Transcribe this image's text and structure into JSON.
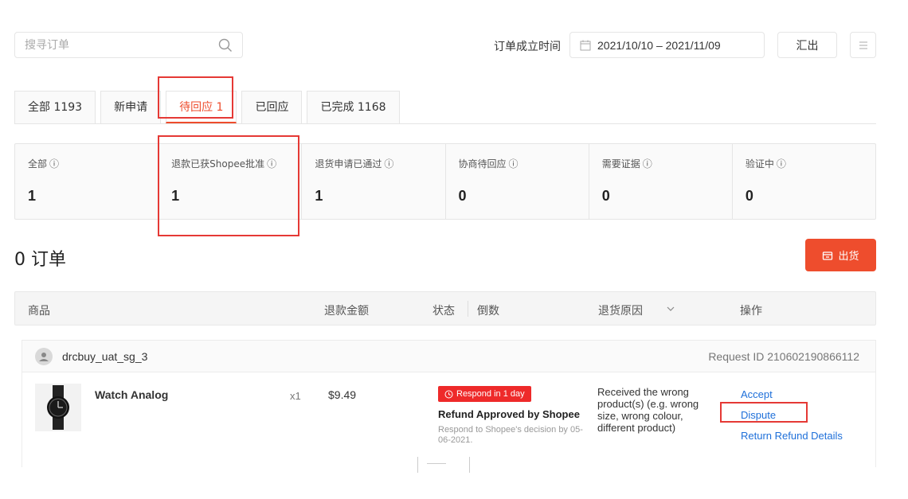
{
  "search": {
    "placeholder": "搜寻订单"
  },
  "date_filter": {
    "label": "订单成立时间",
    "range": "2021/10/10 – 2021/11/09"
  },
  "export_label": "汇出",
  "tabs": [
    {
      "label": "全部 1193",
      "active": false
    },
    {
      "label": "新申请",
      "active": false
    },
    {
      "label": "待回应 1",
      "active": true
    },
    {
      "label": "已回应",
      "active": false
    },
    {
      "label": "已完成 1168",
      "active": false
    }
  ],
  "stats": [
    {
      "label": "全部",
      "value": "1"
    },
    {
      "label": "退款已获Shopee批准",
      "value": "1"
    },
    {
      "label": "退货申请已通过",
      "value": "1"
    },
    {
      "label": "协商待回应",
      "value": "0"
    },
    {
      "label": "需要证据",
      "value": "0"
    },
    {
      "label": "验证中",
      "value": "0"
    }
  ],
  "orders_title": "0 订单",
  "ship_label": "出货",
  "table_head": {
    "product": "商品",
    "refund_amount": "退款金额",
    "status": "状态",
    "countdown": "倒数",
    "reason": "退货原因",
    "actions": "操作"
  },
  "order": {
    "buyer": "drcbuy_uat_sg_3",
    "request_id": "Request ID 210602190866112",
    "product_name": "Watch Analog",
    "qty": "x1",
    "price": "$9.49",
    "respond_badge": "Respond in 1 day",
    "status_title": "Refund Approved by Shopee",
    "status_note": "Respond to Shopee's decision by 05-06-2021.",
    "reason": "Received the wrong product(s) (e.g. wrong size, wrong colour, different product)",
    "actions": {
      "accept": "Accept",
      "dispute": "Dispute",
      "details": "Return Refund Details"
    }
  },
  "colors": {
    "accent": "#ee4d2d",
    "link": "#1e6fd9",
    "highlight": "#e53935"
  }
}
